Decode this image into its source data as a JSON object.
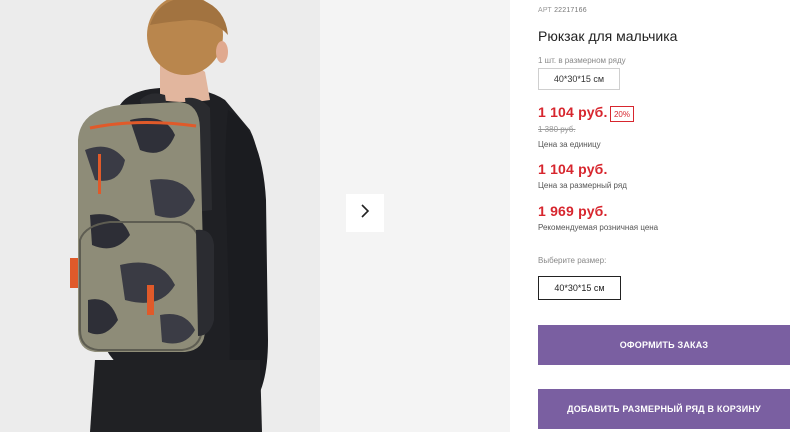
{
  "gallery": {
    "image_alt": "backpack-on-boy",
    "next_icon": "chevron-right-icon"
  },
  "product": {
    "sku_label": "АРТ",
    "sku_value": "22217166",
    "title": "Рюкзак для мальчика",
    "row_label": "1 шт. в размерном ряду",
    "row_size": "40*30*15 см",
    "unit_price": "1 104 руб.",
    "discount": "20%",
    "old_price": "1 380 руб.",
    "unit_price_caption": "Цена за единицу",
    "row_price": "1 104 руб.",
    "row_price_caption": "Цена за размерный ряд",
    "retail_price": "1 969 руб.",
    "retail_price_caption": "Рекомендуемая розничная цена",
    "choose_size_label": "Выберите размер:",
    "size_option": "40*30*15 см",
    "order_button": "ОФОРМИТЬ ЗАКАЗ",
    "add_row_button": "ДОБАВИТЬ РАЗМЕРНЫЙ РЯД В КОРЗИНУ"
  },
  "colors": {
    "accent": "#7a5fa1",
    "price": "#d7262e"
  }
}
